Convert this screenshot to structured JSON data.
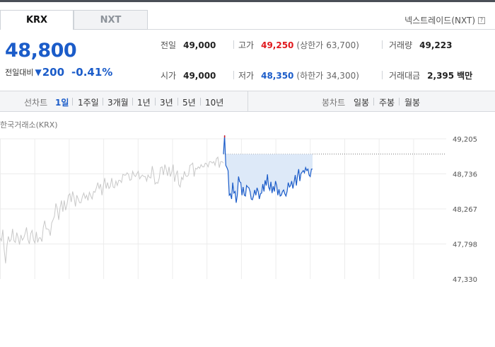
{
  "tabs": {
    "krx": "KRX",
    "nxt": "NXT"
  },
  "nextrade_link": "넥스트레이드(NXT)",
  "help_icon": "?",
  "price": {
    "current": "48,800",
    "change_label": "전일대비",
    "change_direction": "down",
    "change_value": "200",
    "change_rate": "-0.41%"
  },
  "stats": {
    "prev_close_label": "전일",
    "prev_close": "49,000",
    "open_label": "시가",
    "open": "49,000",
    "high_label": "고가",
    "high": "49,250",
    "upper_limit_label": "(상한가",
    "upper_limit": "63,700)",
    "low_label": "저가",
    "low": "48,350",
    "lower_limit_label": "(하한가",
    "lower_limit": "34,300)",
    "volume_label": "거래량",
    "volume": "49,223",
    "amount_label": "거래대금",
    "amount": "2,395",
    "amount_unit": "백만"
  },
  "toolbar": {
    "line_chart_label": "선차트",
    "periods": [
      "1일",
      "1주일",
      "3개월",
      "1년",
      "3년",
      "5년",
      "10년"
    ],
    "active_period": "1일",
    "candle_chart_label": "봉차트",
    "candles": [
      "일봉",
      "주봉",
      "월봉"
    ]
  },
  "chart_label": "한국거래소(KRX)",
  "colors": {
    "rise": "#e0191e",
    "fall": "#1b5cc9",
    "history_line": "#c8c8c8",
    "today_fill": "#dde9f8"
  },
  "chart_data": {
    "type": "line",
    "y_ticks": [
      "49,205",
      "48,736",
      "48,267",
      "47,798",
      "47,330"
    ],
    "ylim": [
      47330,
      49205
    ],
    "reference_price": 49000,
    "grid": true,
    "series": [
      {
        "values": [
          47880,
          47840,
          47990,
          47720,
          47540,
          47780,
          47900,
          47830,
          47860,
          48000,
          47840,
          47820,
          47950,
          47880,
          47790,
          47920,
          47850,
          47880,
          47940,
          48020,
          47860,
          47800,
          47940,
          47980,
          47850,
          47810,
          47960,
          47820,
          47880,
          47880,
          47830,
          48020,
          48110,
          48000,
          48000,
          47990,
          47910,
          48080,
          48120,
          48170,
          48340,
          48270,
          48120,
          48280,
          48380,
          48230,
          48380,
          48250,
          48330,
          48450,
          48470,
          48360,
          48500,
          48420,
          48300,
          48450,
          48400,
          48350,
          48350,
          48430,
          48480,
          48410,
          48450,
          48380,
          48490,
          48440,
          48400,
          48500,
          48490,
          48550,
          48620,
          48540,
          48600,
          48450,
          48580,
          48680,
          48540,
          48620,
          48540,
          48570,
          48680,
          48560,
          48550,
          48640,
          48580,
          48650,
          48650,
          48620,
          48730,
          48720,
          48720,
          48750,
          48730,
          48650,
          48660,
          48770,
          48720,
          48700,
          48740,
          48770,
          48670,
          48700,
          48720,
          48700,
          48700,
          48640,
          48720,
          48690,
          48680,
          48840,
          48740,
          48600,
          48620,
          48610,
          48680,
          48820,
          48830,
          48720,
          48860,
          48800,
          48710,
          48830,
          48700,
          48760,
          48860,
          48630,
          48720,
          48780,
          48590,
          48560,
          48690,
          48660,
          48770,
          48710,
          48700,
          48720,
          48850,
          48860,
          48880,
          48700,
          48810,
          48800,
          48830,
          48810,
          48860,
          48830,
          48830,
          48880,
          48870,
          48830,
          48900,
          48900,
          48880,
          48900,
          48850,
          48940,
          48960,
          48820,
          48900,
          48900,
          48880
        ]
      },
      {
        "values": [
          49000,
          49250,
          48850,
          48820,
          48780,
          48450,
          48470,
          48400,
          48620,
          48480,
          48500,
          48350,
          48450,
          48700,
          48630,
          48620,
          48450,
          48560,
          48450,
          48440,
          48580,
          48560,
          48550,
          48500,
          48400,
          48390,
          48440,
          48520,
          48450,
          48550,
          48500,
          48400,
          48470,
          48480,
          48600,
          48500,
          48650,
          48580,
          48730,
          48560,
          48520,
          48630,
          48480,
          48570,
          48500,
          48640,
          48580,
          48450,
          48530,
          48440,
          48450,
          48500,
          48520,
          48470,
          48440,
          48500,
          48620,
          48560,
          48580,
          48640,
          48540,
          48620,
          48720,
          48580,
          48710,
          48800,
          48640,
          48740,
          48760,
          48780,
          48750,
          48820,
          48780,
          48800,
          48720,
          48700,
          48800,
          48800
        ]
      }
    ]
  }
}
